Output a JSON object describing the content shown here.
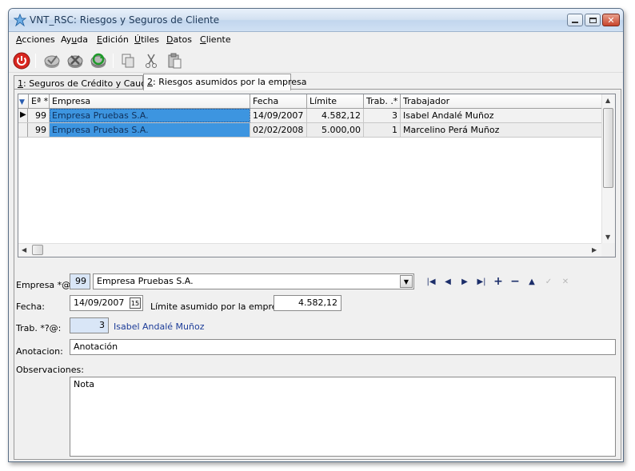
{
  "window": {
    "title": "VNT_RSC: Riesgos y Seguros de Cliente"
  },
  "menu": [
    {
      "label": "Acciones",
      "key": "A",
      "rest": "cciones"
    },
    {
      "label": "Ayuda",
      "key": "u",
      "pre": "Ay",
      "rest": "da"
    },
    {
      "label": "Edición",
      "key": "E",
      "rest": "dición"
    },
    {
      "label": "Útiles",
      "key": "Ú",
      "rest": "tiles"
    },
    {
      "label": "Datos",
      "key": "D",
      "rest": "atos"
    },
    {
      "label": "Cliente",
      "key": "C",
      "rest": "liente"
    }
  ],
  "tabs": [
    {
      "key": "1",
      "label": ": Seguros de Crédito y Caución"
    },
    {
      "key": "2",
      "label": ": Riesgos asumidos por la empresa"
    }
  ],
  "grid": {
    "headers": [
      "Eª *",
      "Empresa",
      "Fecha",
      "Límite",
      "Trab. .*",
      "Trabajador"
    ],
    "rows": [
      {
        "ea": "99",
        "empresa": "Empresa Pruebas S.A.",
        "fecha": "14/09/2007",
        "limite": "4.582,12",
        "trab": "3",
        "trabajador": "Isabel Andalé Muñoz"
      },
      {
        "ea": "99",
        "empresa": "Empresa Pruebas S.A.",
        "fecha": "02/02/2008",
        "limite": "5.000,00",
        "trab": "1",
        "trabajador": "Marcelino Perá Muñoz"
      }
    ]
  },
  "form": {
    "empresa_label": "Empresa *@:",
    "empresa_code": "99",
    "empresa_name": "Empresa Pruebas S.A.",
    "fecha_label": "Fecha:",
    "fecha_value": "14/09/2007",
    "limite_label": "Límite asumido por la empresa:",
    "limite_value": "4.582,12",
    "trab_label": "Trab. *?@:",
    "trab_code": "3",
    "trab_name": "Isabel Andalé Muñoz",
    "anotacion_label": "Anotacion:",
    "anotacion_value": "Anotación",
    "observaciones_label": "Observaciones:",
    "observaciones_value": "Nota"
  },
  "colors": {
    "selection": "#3d95e0",
    "accent_nav": "#1c2e6a"
  },
  "icons": {
    "toolbar": [
      "power-icon",
      "accept-icon",
      "cancel-icon",
      "refresh-icon",
      "copy-icon",
      "cut-icon",
      "paste-icon"
    ],
    "nav": [
      "first-record-icon",
      "previous-record-icon",
      "next-record-icon",
      "last-record-icon",
      "add-record-icon",
      "delete-record-icon",
      "edit-record-icon",
      "confirm-icon",
      "cancel-edit-icon"
    ]
  }
}
